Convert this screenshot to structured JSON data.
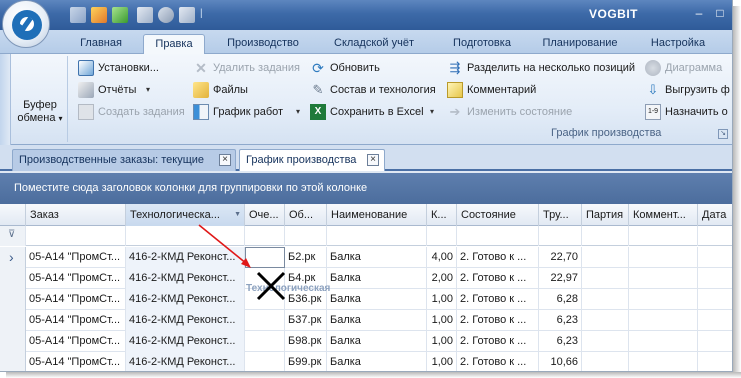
{
  "app": {
    "title": "VOGBIT",
    "qat_separator": "|"
  },
  "window_controls": {
    "minimize": "–",
    "maximize": "□"
  },
  "ribbon_tabs": [
    {
      "label": "Главная",
      "active": false
    },
    {
      "label": "Правка",
      "active": true
    },
    {
      "label": "Производство",
      "active": false
    },
    {
      "label": "Складской учёт",
      "active": false
    },
    {
      "label": "Подготовка",
      "active": false
    },
    {
      "label": "Планирование",
      "active": false
    },
    {
      "label": "Настройка",
      "active": false
    }
  ],
  "clipboard": {
    "label": "Буфер обмена",
    "dropdown": "▾"
  },
  "ribbon_items": {
    "settings": "Установки...",
    "reports": "Отчёты",
    "create_tasks": "Создать задания",
    "delete_tasks": "Удалить задания",
    "files": "Файлы",
    "work_schedule": "График работ",
    "refresh": "Обновить",
    "composition": "Состав и технология",
    "save_excel": "Сохранить в Excel",
    "split": "Разделить на несколько позиций",
    "comment": "Комментарий",
    "change_state": "Изменить состояние",
    "diagram": "Диаграмма",
    "export": "Выгрузить ф",
    "assign": "Назначить о",
    "dropdown": "▾"
  },
  "ribbon_group_label": "График производства",
  "doc_tabs": [
    {
      "label": "Производственные заказы: текущие",
      "active": false
    },
    {
      "label": "График производства",
      "active": true
    }
  ],
  "close_glyph": "×",
  "group_panel_text": "Поместите сюда заголовок колонки для группировки по этой колонке",
  "grid": {
    "columns": [
      "Заказ",
      "Технологическа...",
      "Оче...",
      "Об...",
      "Наименование",
      "К...",
      "Состояние",
      "Тру...",
      "Партия",
      "Коммент...",
      "Дата"
    ],
    "filter_icon": "▼",
    "row_indicator": "›",
    "rows": [
      [
        "05-А14 \"ПромСт...",
        "416-2-КМД Реконст...",
        "",
        "Б2.рк",
        "Балка",
        "4,00",
        "2. Готово к ...",
        "22,70",
        "",
        "",
        ""
      ],
      [
        "05-А14 \"ПромСт...",
        "416-2-КМД Реконст...",
        "",
        "Б4.рк",
        "Балка",
        "2,00",
        "2. Готово к ...",
        "22,97",
        "",
        "",
        ""
      ],
      [
        "05-А14 \"ПромСт...",
        "416-2-КМД Реконст...",
        "",
        "Б36.рк",
        "Балка",
        "1,00",
        "2. Готово к ...",
        "6,28",
        "",
        "",
        ""
      ],
      [
        "05-А14 \"ПромСт...",
        "416-2-КМД Реконст...",
        "",
        "Б37.рк",
        "Балка",
        "1,00",
        "2. Готово к ...",
        "6,23",
        "",
        "",
        ""
      ],
      [
        "05-А14 \"ПромСт...",
        "416-2-КМД Реконст...",
        "",
        "Б98.рк",
        "Балка",
        "1,00",
        "2. Готово к ...",
        "6,23",
        "",
        "",
        ""
      ],
      [
        "05-А14 \"ПромСт...",
        "416-2-КМД Реконст...",
        "",
        "Б99.рк",
        "Балка",
        "1,00",
        "2. Готово к ...",
        "10,66",
        "",
        "",
        ""
      ]
    ]
  },
  "drag_ghost_label": "Технологическая",
  "colors": {
    "accent": "#2f5b99",
    "arrow": "#e01818",
    "group_panel": "#4c6d9d"
  },
  "icons": [
    "app-logo-icon",
    "settings-icon",
    "reports-icon",
    "create-tasks-icon",
    "delete-icon",
    "files-icon",
    "schedule-icon",
    "refresh-icon",
    "wrench-icon",
    "excel-icon",
    "split-icon",
    "comment-icon",
    "change-state-icon",
    "diagram-icon",
    "export-icon",
    "assign-icon",
    "filter-icon",
    "drop-x-icon",
    "red-arrow-icon"
  ]
}
